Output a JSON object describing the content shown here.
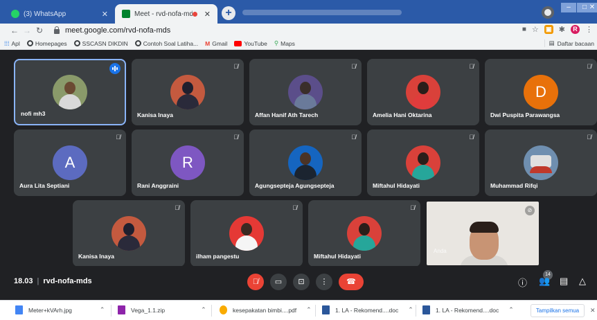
{
  "browser": {
    "tabs": [
      {
        "title": "(3) WhatsApp",
        "favicon": "whatsapp-icon",
        "active": false
      },
      {
        "title": "Meet - rvd-nofa-mds",
        "favicon": "meet-icon",
        "active": true
      }
    ],
    "url": "meet.google.com/rvd-nofa-mds",
    "bookmarks": [
      {
        "label": "Apl",
        "icon": "apps-grid-icon"
      },
      {
        "label": "Homepages",
        "icon": "globe-icon"
      },
      {
        "label": "SSCASN DIKDIN",
        "icon": "globe-icon"
      },
      {
        "label": "Contoh Soal Latiha...",
        "icon": "globe-icon"
      },
      {
        "label": "Gmail",
        "icon": "gmail-icon"
      },
      {
        "label": "YouTube",
        "icon": "youtube-icon"
      },
      {
        "label": "Maps",
        "icon": "maps-icon"
      }
    ],
    "reading_list": "Daftar bacaan"
  },
  "meet": {
    "participants": [
      {
        "name": "nofi mh3",
        "type": "photo",
        "speaking": true
      },
      {
        "name": "Kanisa Inaya",
        "type": "photo",
        "muted": true
      },
      {
        "name": "Affan Hanif Ath Tarech",
        "type": "photo",
        "muted": true
      },
      {
        "name": "Amelia Hani Oktarina",
        "type": "photo",
        "muted": true
      },
      {
        "name": "Dwi Puspita Parawangsa",
        "type": "letter",
        "letter": "D",
        "color": "#e8710a",
        "muted": true
      },
      {
        "name": "Aura Lita Septiani",
        "type": "letter",
        "letter": "A",
        "color": "#5c6bc0",
        "muted": true
      },
      {
        "name": "Rani Anggraini",
        "type": "letter",
        "letter": "R",
        "color": "#7e57c2",
        "muted": true
      },
      {
        "name": "Agungsepteja Agungsepteja",
        "type": "photo",
        "muted": true
      },
      {
        "name": "Miftahul Hidayati",
        "type": "photo",
        "muted": true
      },
      {
        "name": "Muhammad Rifqi",
        "type": "photo",
        "muted": true
      },
      {
        "name": "Kanisa Inaya",
        "type": "photo",
        "muted": true
      },
      {
        "name": "ilham pangestu",
        "type": "photo",
        "muted": true
      },
      {
        "name": "Miftahul Hidayati",
        "type": "photo",
        "muted": true
      }
    ],
    "self_label": "Anda",
    "time": "18.03",
    "meeting_code": "rvd-nofa-mds",
    "participant_count": "14"
  },
  "downloads": [
    {
      "name": "Meter+kVArh.jpg",
      "icon": "image-file-icon"
    },
    {
      "name": "Vega_1.1.zip",
      "icon": "zip-file-icon"
    },
    {
      "name": "kesepakatan bimbi....pdf",
      "icon": "pdf-file-icon"
    },
    {
      "name": "1. LA - Rekomend....doc",
      "icon": "word-file-icon"
    },
    {
      "name": "1. LA - Rekomend....doc",
      "icon": "word-file-icon"
    }
  ],
  "show_all": "Tampilkan semua",
  "colors": {
    "tabstrip": "#2b5aa8",
    "meet_bg": "#202124",
    "tile_bg": "#3c4043",
    "hangup": "#ea4335",
    "speaking_ring": "#8ab4f8"
  }
}
